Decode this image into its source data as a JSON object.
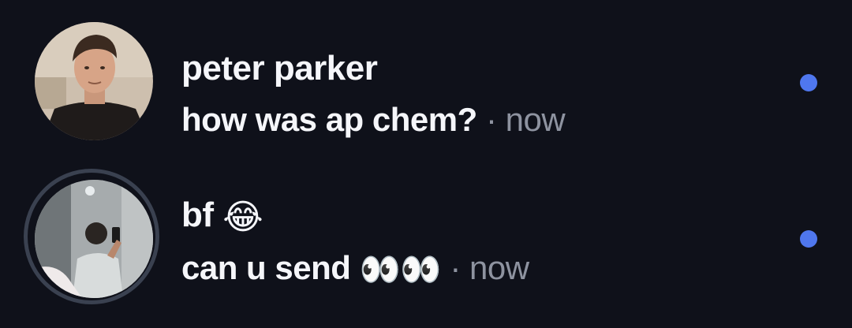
{
  "conversations": [
    {
      "name": "peter parker",
      "name_emoji": "",
      "preview": "how was ap chem?",
      "preview_emoji": "",
      "separator": "·",
      "time": "now",
      "unread": true,
      "has_story_ring": false
    },
    {
      "name": "bf",
      "name_emoji": "😂",
      "preview": "can u send",
      "preview_emoji": "👀👀",
      "separator": "·",
      "time": "now",
      "unread": true,
      "has_story_ring": true
    }
  ],
  "colors": {
    "background": "#0f111a",
    "text_primary": "#f5f6fa",
    "text_secondary": "#8e93a0",
    "unread_dot": "#4f77ee",
    "story_ring": "#3a4150"
  }
}
